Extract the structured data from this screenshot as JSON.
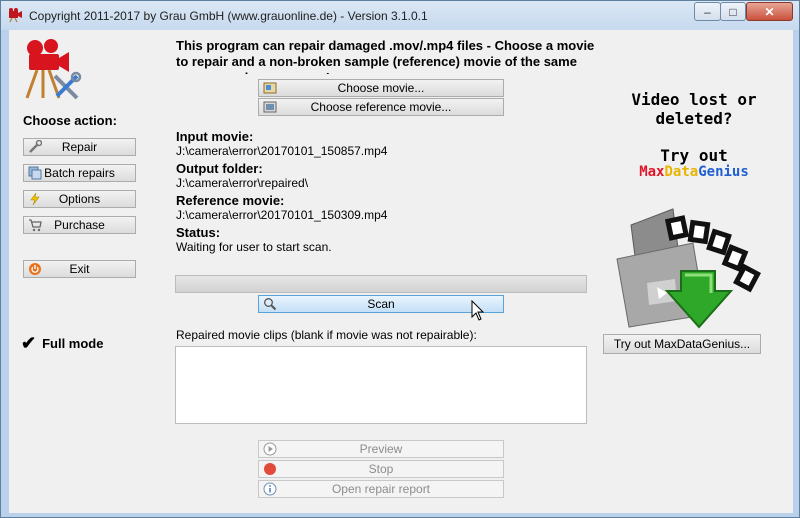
{
  "window": {
    "title": "Copyright 2011-2017 by Grau GmbH (www.grauonline.de) - Version 3.1.0.1",
    "controls": {
      "minimize": "–",
      "maximize": "□",
      "close": "✕"
    }
  },
  "sidebar": {
    "heading": "Choose action:",
    "buttons": {
      "repair": "Repair",
      "batch": "Batch repairs",
      "options": "Options",
      "purchase": "Purchase",
      "exit": "Exit"
    },
    "mode": "Full mode",
    "check_glyph": "✔"
  },
  "main": {
    "intro": "This program can repair damaged .mov/.mp4 files - Choose a movie to repair and a non-broken sample (reference) movie of the same camera and same scene!",
    "choose_movie": "Choose movie...",
    "choose_reference": "Choose reference movie...",
    "input_label": "Input movie:",
    "input_value": "J:\\camera\\error\\20170101_150857.mp4",
    "output_label": "Output folder:",
    "output_value": "J:\\camera\\error\\repaired\\",
    "reference_label": "Reference movie:",
    "reference_value": "J:\\camera\\error\\20170101_150309.mp4",
    "status_label": "Status:",
    "status_value": "Waiting for user to start scan.",
    "progress": 0,
    "scan": "Scan",
    "clips_label": "Repaired movie clips (blank if movie was not repairable):",
    "preview": "Preview",
    "stop": "Stop",
    "open_report": "Open repair report"
  },
  "ad": {
    "line1": "Video lost or",
    "line2": "deleted?",
    "line3": "Try out",
    "brand_part1": "Max",
    "brand_part2": "Data",
    "brand_part3": "Genius",
    "try_button": "Try out MaxDataGenius...",
    "colors": {
      "max": "#e0162b",
      "data": "#e8b400",
      "genius": "#1f5fd1"
    }
  }
}
